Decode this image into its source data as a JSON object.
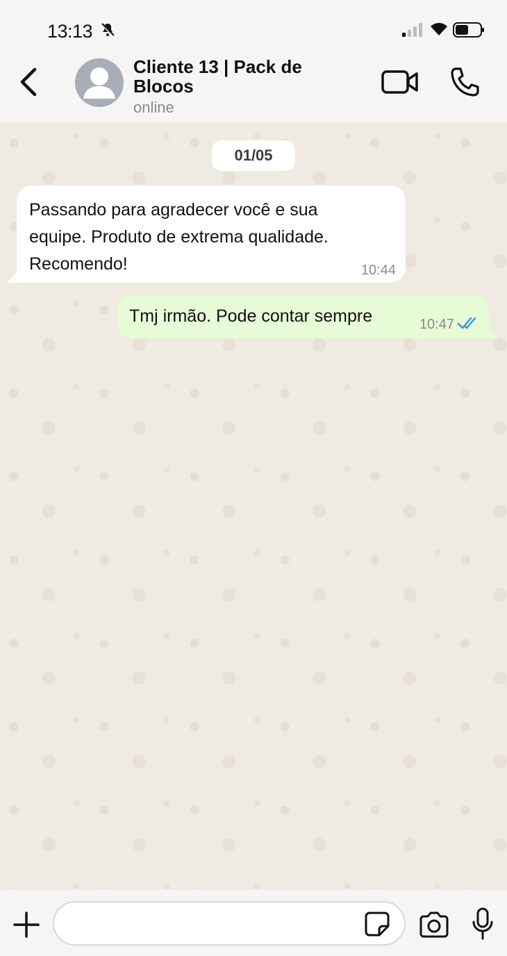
{
  "status_bar": {
    "time": "13:13",
    "icons": [
      "bell-off-icon",
      "signal-icon",
      "wifi-icon",
      "battery-icon"
    ]
  },
  "header": {
    "contact_name": "Cliente 13 | Pack de Blocos",
    "contact_status": "online",
    "icons": [
      "back-chevron-icon",
      "avatar-placeholder-icon",
      "video-call-icon",
      "phone-icon"
    ]
  },
  "chat": {
    "date_chip": "01/05",
    "messages": [
      {
        "direction": "incoming",
        "text": "Passando para agradecer você e sua equipe. Produto de extrema qualidade. Recomendo!",
        "time": "10:44"
      },
      {
        "direction": "outgoing",
        "text": "Tmj irmão. Pode contar sempre",
        "time": "10:47",
        "read_status": "read"
      }
    ]
  },
  "composer": {
    "placeholder": "",
    "icons": [
      "plus-icon",
      "sticker-icon",
      "camera-icon",
      "microphone-icon"
    ]
  },
  "colors": {
    "incoming_bubble": "#ffffff",
    "outgoing_bubble": "#e6fbd6",
    "read_ticks": "#3d8fe0",
    "chat_background": "#efeae2"
  }
}
